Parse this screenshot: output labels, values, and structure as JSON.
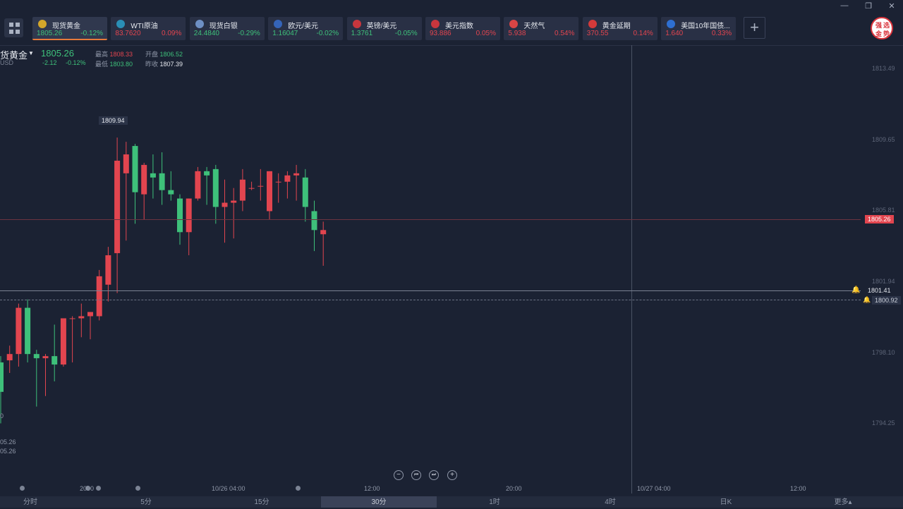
{
  "window": {
    "minimize": "—",
    "restore": "❐",
    "close": "✕"
  },
  "tickers": [
    {
      "name": "现货黄金",
      "price": "1805.26",
      "change": "-0.12%",
      "dir": "dn",
      "icon_color": "#d3a62a",
      "icon": "coin-icon",
      "active": true
    },
    {
      "name": "WTI原油",
      "price": "83.7620",
      "change": "0.09%",
      "dir": "up",
      "icon_color": "#2a8fb6",
      "icon": "oil-icon",
      "active": false
    },
    {
      "name": "现货白银",
      "price": "24.4840",
      "change": "-0.29%",
      "dir": "dn",
      "icon_color": "#6e8fc4",
      "icon": "silver-icon",
      "active": false
    },
    {
      "name": "欧元/美元",
      "price": "1.16047",
      "change": "-0.02%",
      "dir": "dn",
      "icon_color": "#3564b9",
      "icon": "eu-flag-icon",
      "active": false
    },
    {
      "name": "英镑/美元",
      "price": "1.3761",
      "change": "-0.05%",
      "dir": "dn",
      "icon_color": "#c8363d",
      "icon": "uk-flag-icon",
      "active": false
    },
    {
      "name": "美元指数",
      "price": "93.886",
      "change": "0.05%",
      "dir": "up",
      "icon_color": "#c8363d",
      "icon": "us-flag-icon",
      "active": false
    },
    {
      "name": "天然气",
      "price": "5.938",
      "change": "0.54%",
      "dir": "up",
      "icon_color": "#d94545",
      "icon": "flame-icon",
      "active": false
    },
    {
      "name": "黄金延期",
      "price": "370.55",
      "change": "0.14%",
      "dir": "up",
      "icon_color": "#d33a3a",
      "icon": "gold-bar-icon",
      "active": false
    },
    {
      "name": "美国10年国债...",
      "price": "1.640",
      "change": "0.33%",
      "dir": "up",
      "icon_color": "#2e6fd1",
      "icon": "bond-chart-icon",
      "active": false
    }
  ],
  "logo": {
    "chars": [
      "强",
      "选",
      "金",
      "势"
    ]
  },
  "symbol": {
    "name": "货黄金",
    "price": "1805.26",
    "sub": "USD",
    "change": "-2.12",
    "change_pct": "-0.12%",
    "high_label": "最高",
    "high": "1808.33",
    "open_label": "开盘",
    "open": "1806.52",
    "low_label": "最低",
    "low": "1803.80",
    "prev_label": "昨收",
    "prev": "1807.39"
  },
  "y_axis": [
    "1813.49",
    "1809.65",
    "1805.81",
    "1801.94",
    "1798.10",
    "1794.25"
  ],
  "price_tags": {
    "current": "1805.26",
    "crosshair": "1801.41",
    "alert": "1800.92",
    "max_label": "1809.94"
  },
  "left_labels": [
    "0",
    "05.26",
    "05.26"
  ],
  "x_axis": [
    "2000",
    "10/26 04:00",
    "12:00",
    "20:00",
    "10/27 04:00",
    "12:00"
  ],
  "timeframes": [
    "分时",
    "5分",
    "15分",
    "30分",
    "1时",
    "4时",
    "日K",
    "更多"
  ],
  "selected_timeframe": "30分",
  "colors": {
    "up": "#e2454f",
    "down": "#3ec07a",
    "bg": "#1b2233"
  },
  "chart_data": {
    "type": "candlestick",
    "ylim": [
      1793.5,
      1814.3
    ],
    "candles": [
      [
        1799.2,
        1799.5,
        1796.3,
        1797.8
      ],
      [
        1799.3,
        1800.0,
        1798.7,
        1799.6
      ],
      [
        1799.6,
        1802.0,
        1799.0,
        1801.8
      ],
      [
        1801.8,
        1802.2,
        1799.2,
        1799.6
      ],
      [
        1799.6,
        1799.8,
        1797.1,
        1799.4
      ],
      [
        1799.4,
        1799.6,
        1797.6,
        1799.5
      ],
      [
        1799.5,
        1801.0,
        1798.3,
        1799.1
      ],
      [
        1799.1,
        1801.3,
        1799.0,
        1801.3
      ],
      [
        1801.3,
        1801.4,
        1799.2,
        1801.3
      ],
      [
        1801.3,
        1802.0,
        1800.4,
        1801.4
      ],
      [
        1801.4,
        1801.6,
        1800.3,
        1801.6
      ],
      [
        1801.4,
        1803.6,
        1801.2,
        1803.3
      ],
      [
        1802.9,
        1804.7,
        1802.1,
        1804.3
      ],
      [
        1804.4,
        1809.9,
        1802.5,
        1808.8
      ],
      [
        1808.2,
        1809.7,
        1805.0,
        1809.1
      ],
      [
        1809.5,
        1809.6,
        1805.8,
        1807.3
      ],
      [
        1807.2,
        1808.7,
        1806.0,
        1808.6
      ],
      [
        1808.2,
        1809.1,
        1807.0,
        1808.0
      ],
      [
        1808.2,
        1809.2,
        1806.7,
        1807.4
      ],
      [
        1807.4,
        1808.3,
        1806.9,
        1807.2
      ],
      [
        1807.0,
        1807.2,
        1804.8,
        1805.4
      ],
      [
        1805.4,
        1807.0,
        1804.3,
        1807.0
      ],
      [
        1807.0,
        1808.5,
        1806.9,
        1808.3
      ],
      [
        1808.3,
        1808.5,
        1806.7,
        1808.1
      ],
      [
        1808.4,
        1808.6,
        1805.8,
        1806.6
      ],
      [
        1806.6,
        1807.9,
        1804.9,
        1806.8
      ],
      [
        1806.8,
        1807.5,
        1805.1,
        1806.9
      ],
      [
        1806.9,
        1808.4,
        1806.4,
        1807.9
      ],
      [
        1807.5,
        1807.8,
        1807.4,
        1807.5
      ],
      [
        1807.6,
        1808.4,
        1806.9,
        1807.6
      ],
      [
        1806.4,
        1808.3,
        1806.0,
        1808.3
      ],
      [
        1807.8,
        1808.2,
        1806.8,
        1807.8
      ],
      [
        1807.8,
        1808.3,
        1807.0,
        1808.1
      ],
      [
        1808.1,
        1808.6,
        1806.9,
        1808.2
      ],
      [
        1808.0,
        1808.4,
        1805.9,
        1806.6
      ],
      [
        1806.4,
        1806.9,
        1804.5,
        1805.5
      ],
      [
        1805.3,
        1805.9,
        1803.8,
        1805.5
      ]
    ]
  }
}
